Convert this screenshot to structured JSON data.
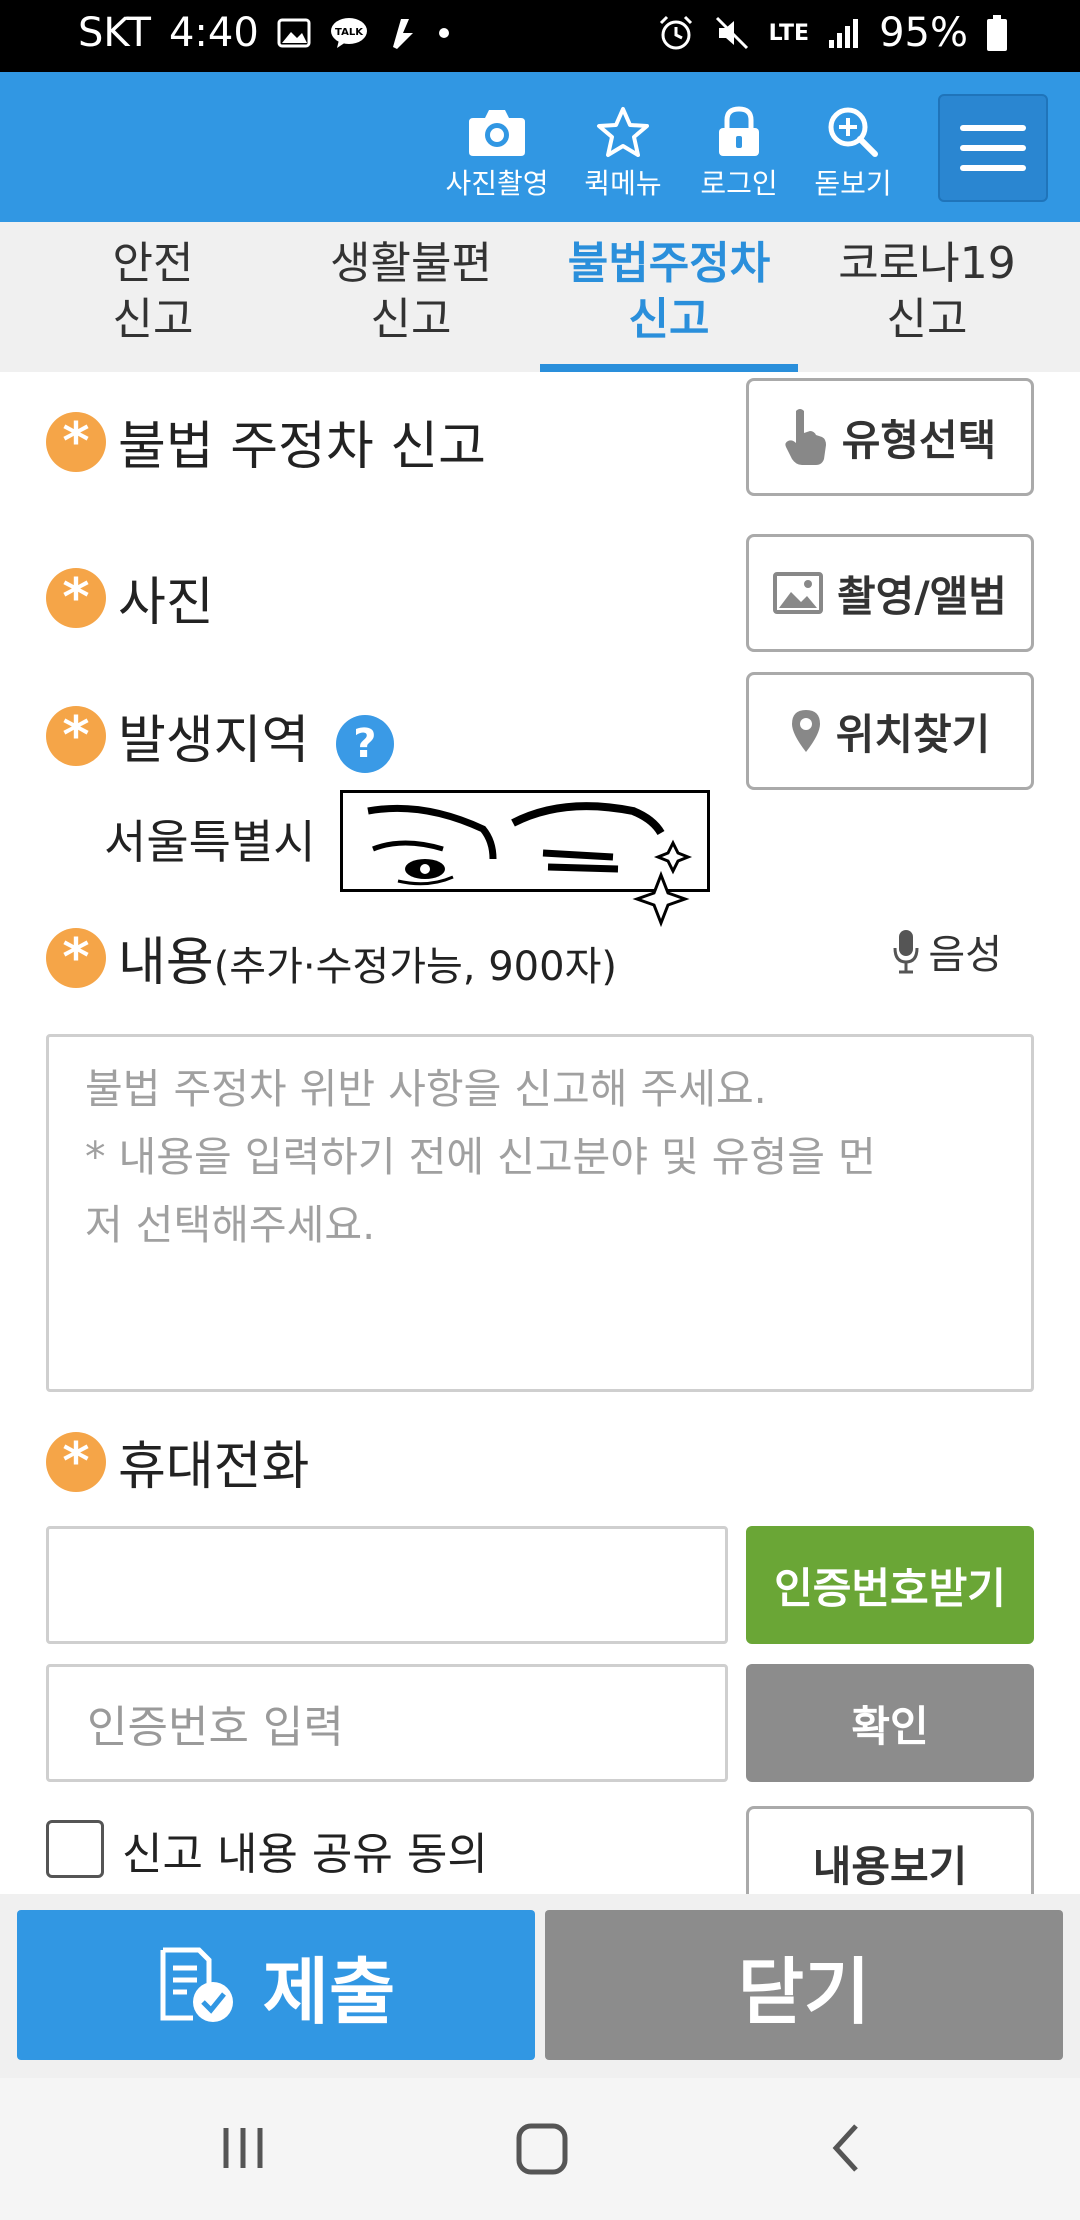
{
  "status_bar": {
    "carrier": "SKT",
    "time": "4:40",
    "network": "LTE",
    "battery": "95%"
  },
  "header": {
    "buttons": [
      {
        "label": "사진촬영",
        "icon": "camera-icon"
      },
      {
        "label": "퀵메뉴",
        "icon": "star-icon"
      },
      {
        "label": "로그인",
        "icon": "lock-icon"
      },
      {
        "label": "돋보기",
        "icon": "zoom-in-icon"
      }
    ],
    "menu_icon": "hamburger-menu-icon",
    "color": "#3197e3"
  },
  "tabs": [
    {
      "line1": "안전",
      "line2": "신고",
      "active": false
    },
    {
      "line1": "생활불편",
      "line2": "신고",
      "active": false
    },
    {
      "line1": "불법주정차",
      "line2": "신고",
      "active": true
    },
    {
      "line1": "코로나19",
      "line2": "신고",
      "active": false
    }
  ],
  "form": {
    "section_title": "불법 주정차 신고",
    "type_select_button": "유형선택",
    "photo_label": "사진",
    "photo_button": "촬영/앨범",
    "region_label": "발생지역",
    "help_icon": "?",
    "location_button": "위치찾기",
    "location_city": "서울특별시",
    "content_label": "내용",
    "content_sub": "(추가·수정가능, 900자)",
    "voice_button": "음성",
    "content_placeholder": "불법 주정차 위반 사항을 신고해 주세요.\n* 내용을 입력하기 전에 신고분야 및 유형을 먼\n저 선택해주세요.",
    "phone_label": "휴대전화",
    "phone_value": "",
    "auth_request_button": "인증번호받기",
    "auth_placeholder": "인증번호 입력",
    "confirm_button": "확인",
    "share_consent_label": "신고 내용 공유 동의",
    "view_content_button": "내용보기",
    "required_mark": "*"
  },
  "actions": {
    "submit": "제출",
    "close": "닫기"
  },
  "colors": {
    "accent": "#3197e3",
    "required": "#f5a548",
    "green": "#6aa636",
    "gray": "#8c8c8c"
  }
}
